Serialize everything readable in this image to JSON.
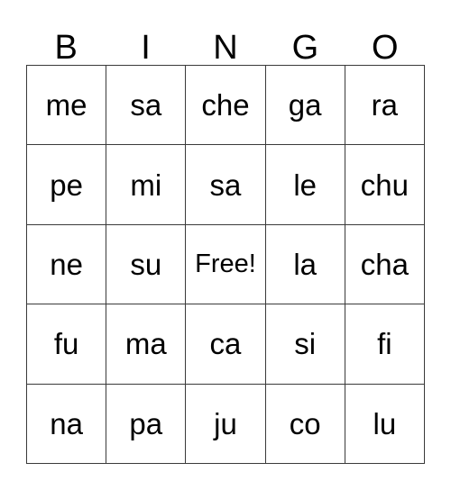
{
  "card": {
    "title": "BINGO",
    "header": [
      "B",
      "I",
      "N",
      "G",
      "O"
    ],
    "free_space_label": "Free!",
    "free_space_position": {
      "row": 2,
      "col": 2
    },
    "colors": {
      "background": "#ffffff",
      "grid_line": "#3a3a3a",
      "text": "#000000"
    },
    "rows": [
      {
        "cells": [
          "me",
          "sa",
          "che",
          "ga",
          "ra"
        ]
      },
      {
        "cells": [
          "pe",
          "mi",
          "sa",
          "le",
          "chu"
        ]
      },
      {
        "cells": [
          "ne",
          "su",
          "Free!",
          "la",
          "cha"
        ]
      },
      {
        "cells": [
          "fu",
          "ma",
          "ca",
          "si",
          "fi"
        ]
      },
      {
        "cells": [
          "na",
          "pa",
          "ju",
          "co",
          "lu"
        ]
      }
    ]
  }
}
